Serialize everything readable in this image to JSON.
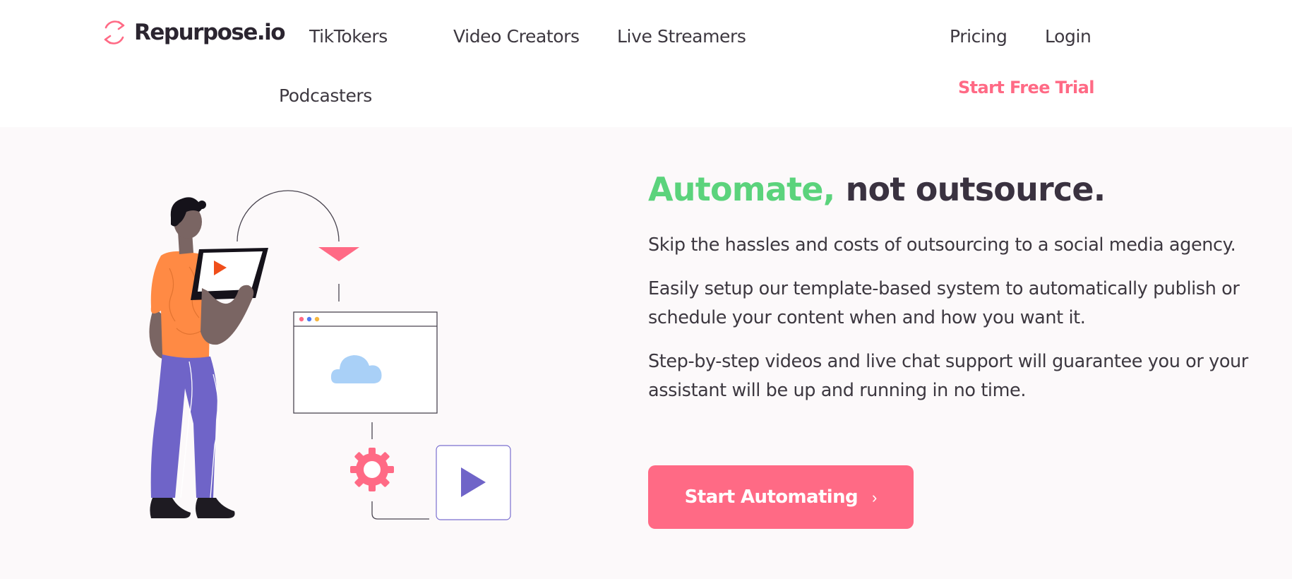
{
  "brand": {
    "name": "Repurpose.io",
    "accent_color": "#ff6a85"
  },
  "nav": {
    "links": [
      {
        "label": "TikTokers"
      },
      {
        "label": "Video Creators"
      },
      {
        "label": "Live Streamers"
      },
      {
        "label": "Podcasters"
      }
    ],
    "pricing": "Pricing",
    "login": "Login",
    "trial": "Start Free Trial"
  },
  "hero": {
    "headline_accent": "Automate,",
    "headline_rest": "not outsource.",
    "paragraphs": [
      "Skip the hassles and costs of outsourcing to a social media agency.",
      "Easily setup our template-based system to automatically publish or schedule your content when and how you want it.",
      "Step-by-step videos and live chat support will guarantee you or your assistant will be up and running in no time."
    ],
    "cta_label": "Start Automating",
    "colors": {
      "accent_green": "#5bd37c",
      "button": "#ff6a85"
    }
  },
  "icons": {
    "logo": "refresh-arrows-icon",
    "cta": "chevron-right-icon",
    "illustration": [
      "play-icon",
      "cloud-icon",
      "gear-icon",
      "funnel-icon"
    ]
  }
}
